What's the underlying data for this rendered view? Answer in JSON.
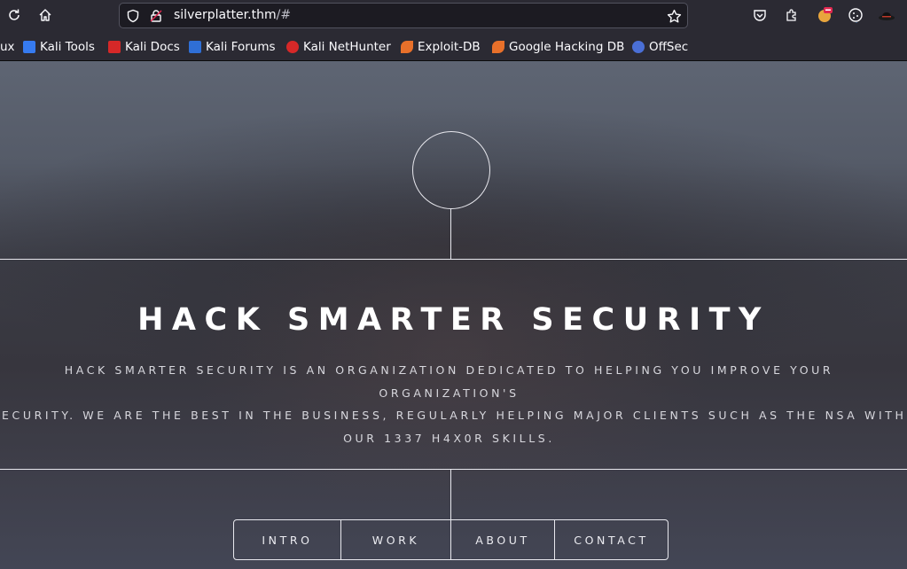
{
  "browser": {
    "url_host": "silverplatter.thm",
    "url_path": "/#",
    "bookmarks": [
      {
        "label": "ux",
        "color": "#367bf0"
      },
      {
        "label": "Kali Tools",
        "color": "#367bf0"
      },
      {
        "label": "Kali Docs",
        "color": "#d62828"
      },
      {
        "label": "Kali Forums",
        "color": "#2f6fd6"
      },
      {
        "label": "Kali NetHunter",
        "color": "#d62828"
      },
      {
        "label": "Exploit-DB",
        "color": "#e8702a"
      },
      {
        "label": "Google Hacking DB",
        "color": "#e8702a"
      },
      {
        "label": "OffSec",
        "color": "#4a6fd6"
      }
    ]
  },
  "hero": {
    "title": "HACK SMARTER SECURITY",
    "description_line1": "HACK SMARTER SECURITY IS AN ORGANIZATION DEDICATED TO HELPING YOU IMPROVE YOUR ORGANIZATION'S",
    "description_line2": "SECURITY. WE ARE THE BEST IN THE BUSINESS, REGULARLY HELPING MAJOR CLIENTS SUCH AS THE NSA WITH",
    "description_line3": "OUR 1337 H4X0R SKILLS."
  },
  "nav": [
    {
      "label": "INTRO"
    },
    {
      "label": "WORK"
    },
    {
      "label": "ABOUT"
    },
    {
      "label": "CONTACT"
    }
  ]
}
